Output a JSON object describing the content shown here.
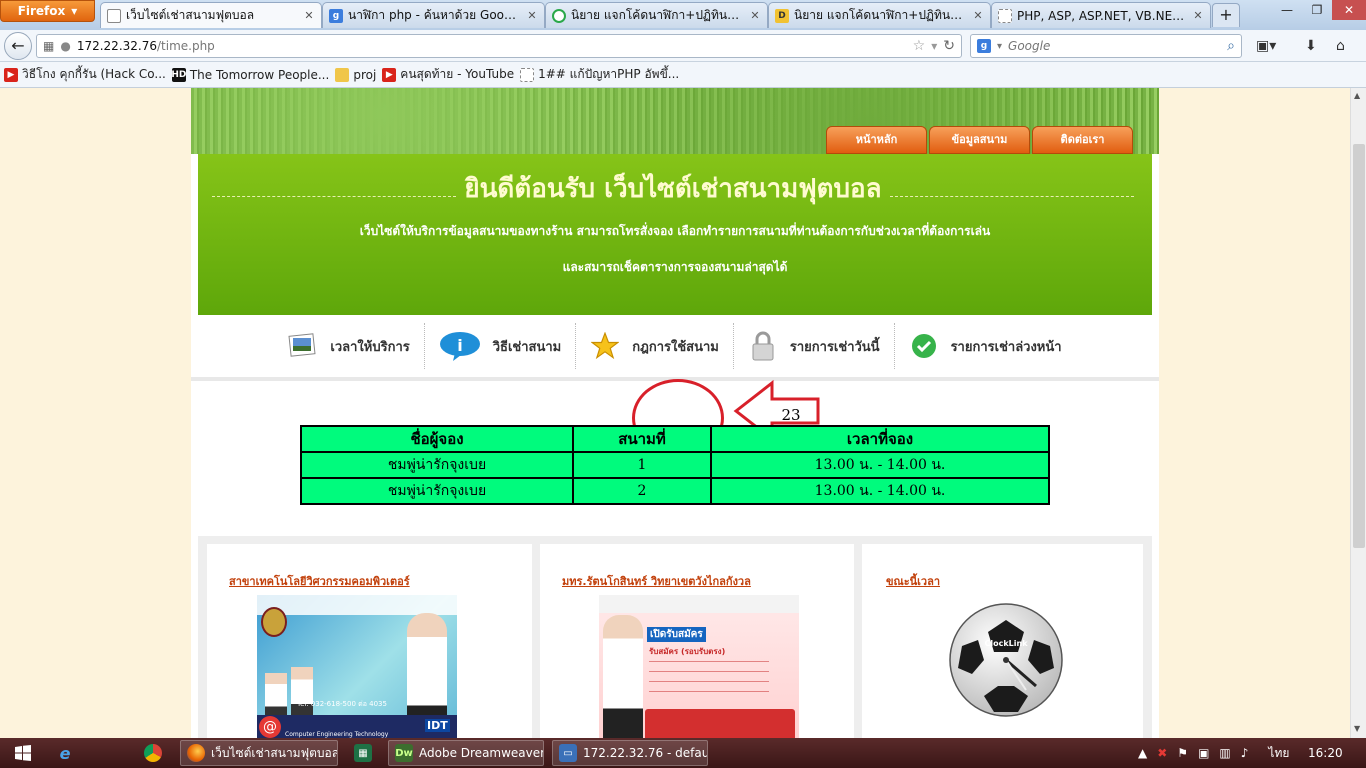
{
  "browser": {
    "menu_button": "Firefox",
    "tabs": [
      {
        "label": "เว็บไซต์เช่าสนามฟุตบอล",
        "active": true
      },
      {
        "label": "นาฬิกา php - ค้นหาด้วย Google",
        "active": false
      },
      {
        "label": "นิยาย แจกโค้ดนาฬิกา+ปฏิทินแปะไ...",
        "active": false
      },
      {
        "label": "นิยาย แจกโค้ดนาฬิกา+ปฏิทินแปะไ...",
        "active": false
      },
      {
        "label": "PHP, ASP, ASP.NET, VB.NET, C#...",
        "active": false
      }
    ],
    "new_tab": "+",
    "url_host": "172.22.32.76",
    "url_path": "/time.php",
    "search_engine": "Google",
    "search_placeholder": "Google",
    "bookmarks": [
      {
        "label": "วิธีโกง คุกกี้รัน (Hack Co...",
        "icon": "youtube-icon"
      },
      {
        "label": "The Tomorrow People...",
        "icon": "hd-icon"
      },
      {
        "label": "proj",
        "icon": "folder-icon"
      },
      {
        "label": "คนสุดท้าย - YouTube",
        "icon": "youtube-icon"
      },
      {
        "label": "1## แก้ปัญหาPHP อัพขึ้...",
        "icon": "page-icon"
      }
    ]
  },
  "site": {
    "top_nav": [
      "หน้าหลัก",
      "ข้อมูลสนาม",
      "ติดต่อเรา"
    ],
    "welcome_title": "ยินดีต้อนรับ เว็บไซต์เช่าสนามฟุตบอล",
    "welcome_line1": "เว็บไซต์ให้บริการข้อมูลสนามของทางร้าน สามารถโทรสั่งจอง เลือกทำรายการสนามที่ท่านต้องการกับช่วงเวลาที่ต้องการเล่น",
    "welcome_line2": "และสมารถเช็คตารางการจองสนามล่าสุดได้",
    "menu": [
      {
        "label": "เวลาให้บริการ",
        "icon": "photo-icon"
      },
      {
        "label": "วิธีเช่าสนาม",
        "icon": "info-icon"
      },
      {
        "label": "กฎการใช้สนาม",
        "icon": "star-icon"
      },
      {
        "label": "รายการเช่าวันนี้",
        "icon": "lock-icon"
      },
      {
        "label": "รายการเช่าล่วงหน้า",
        "icon": "check-icon"
      }
    ],
    "count_value": "23",
    "table": {
      "headers": [
        "ชื่อผู้จอง",
        "สนามที่",
        "เวลาที่จอง"
      ],
      "rows": [
        [
          "ชมพู่น่ารักจุงเบย",
          "1",
          "13.00 น. - 14.00 น."
        ],
        [
          "ชมพู่น่ารักจุงเบย",
          "2",
          "13.00 น. - 14.00 น."
        ]
      ]
    },
    "cards": [
      {
        "title": "สาขาเทคโนโลยีวิศวกรรมคอมพิวเตอร์",
        "poster_text": "Tel. 032-618-500 ต่อ 4035",
        "poster_caption": "Computer Engineering Technology",
        "poster_badge": "IDT"
      },
      {
        "title": "มทร.รัตนโกสินทร์ วิทยาเขตวังไกลกังวล",
        "poster_heading": "เปิดรับสมัคร",
        "poster_sub": "รับสมัคร (รอบรับตรง)"
      },
      {
        "title": "ขณะนี้เวลา",
        "clock_label": "ClockLink"
      }
    ],
    "colors": {
      "green": "#6db513",
      "table_green": "#00fb7d",
      "orange": "#e86a1a",
      "annotation_red": "#d8202a"
    }
  },
  "taskbar": {
    "apps": [
      {
        "label": "เว็บไซต์เช่าสนามฟุตบอล ...",
        "icon": "firefox-icon"
      },
      {
        "label": "Adobe Dreamweaver...",
        "icon": "dreamweaver-icon"
      },
      {
        "label": "172.22.32.76 - default...",
        "icon": "remote-desktop-icon"
      }
    ],
    "language": "ไทย",
    "time": "16:20"
  }
}
